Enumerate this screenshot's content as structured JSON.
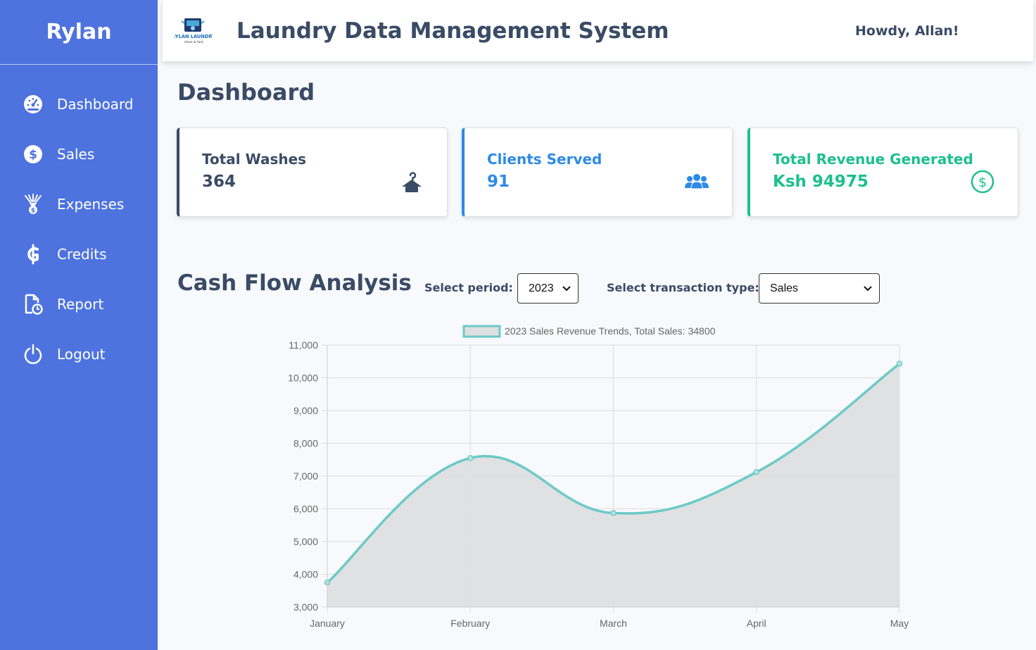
{
  "sidebar": {
    "brand": "Rylan",
    "items": [
      {
        "label": "Dashboard",
        "icon": "dashboard-gauge-icon"
      },
      {
        "label": "Sales",
        "icon": "dollar-circle-icon"
      },
      {
        "label": "Expenses",
        "icon": "money-bag-icon"
      },
      {
        "label": "Credits",
        "icon": "cedi-icon"
      },
      {
        "label": "Report",
        "icon": "report-file-icon"
      },
      {
        "label": "Logout",
        "icon": "power-icon"
      }
    ]
  },
  "header": {
    "logo_text": "RYLAN LAUNDRY",
    "logo_tagline": "clean & fast",
    "title": "Laundry Data Management System",
    "greeting": "Howdy, Allan!"
  },
  "page_title": "Dashboard",
  "cards": [
    {
      "label": "Total Washes",
      "value": "364",
      "icon": "hanger-icon",
      "color": "#3a4b66"
    },
    {
      "label": "Clients Served",
      "value": "91",
      "icon": "users-icon",
      "color": "#2d8ae6"
    },
    {
      "label": "Total Revenue Generated",
      "value": "Ksh 94975",
      "icon": "dollar-circle-icon",
      "color": "#1cc08c"
    }
  ],
  "cashflow": {
    "title": "Cash Flow Analysis",
    "period_label": "Select period:",
    "period_value": "2023",
    "type_label": "Select transaction type:",
    "type_value": "Sales"
  },
  "colors": {
    "sidebar": "#4e73df",
    "line": "#6ccac7",
    "fill": "#dedfe0"
  },
  "chart_data": {
    "type": "line",
    "legend": "2023 Sales Revenue Trends, Total Sales: 34800",
    "categories": [
      "January",
      "February",
      "March",
      "April",
      "May"
    ],
    "values": [
      3750,
      7550,
      5870,
      7120,
      10430
    ],
    "ylim": [
      3000,
      11000
    ],
    "yticks": [
      3000,
      4000,
      5000,
      6000,
      7000,
      8000,
      9000,
      10000,
      11000
    ],
    "ytick_labels": [
      "3,000",
      "4,000",
      "5,000",
      "6,000",
      "7,000",
      "8,000",
      "9,000",
      "10,000",
      "11,000"
    ],
    "fill": true,
    "grid": true,
    "legend_position": "top"
  }
}
